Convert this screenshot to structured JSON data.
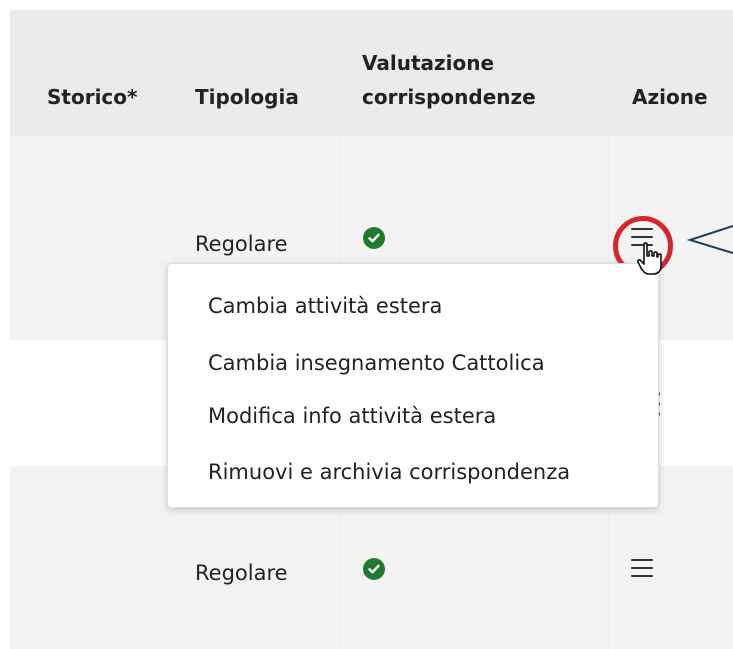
{
  "table": {
    "headers": {
      "storico": "Storico*",
      "tipologia": "Tipologia",
      "valutazione_line1": "Valutazione",
      "valutazione_line2": "corrispondenze",
      "azione": "Azione"
    },
    "rows": [
      {
        "tipologia": "Regolare",
        "valutazione": "check-circle-icon",
        "azione": "menu-icon"
      },
      {
        "tipologia": "",
        "valutazione": "",
        "azione": "kebab-menu-icon"
      },
      {
        "tipologia": "Regolare",
        "valutazione": "check-circle-icon",
        "azione": "menu-icon"
      }
    ]
  },
  "context_menu": {
    "items": [
      "Cambia attività estera",
      "Cambia insegnamento Cattolica",
      "Modifica info attività estera",
      "Rimuovi e archivia corrispondenza"
    ]
  },
  "colors": {
    "header_bg": "#ebebeb",
    "row_alt_bg": "#f3f3f3",
    "check_green": "#1f7a30",
    "highlight_red": "#d6262b",
    "callout_line": "#1f3a6b"
  }
}
